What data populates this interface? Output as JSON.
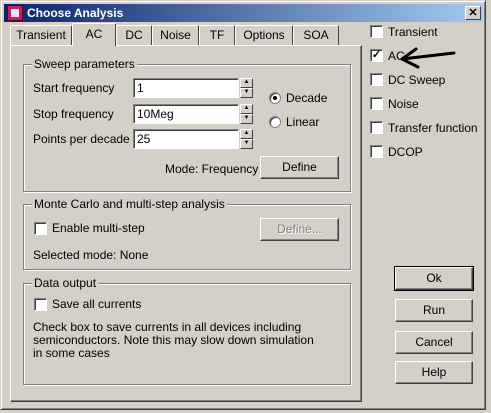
{
  "window": {
    "title": "Choose Analysis",
    "close_glyph": "✕"
  },
  "tabs": [
    "Transient",
    "AC",
    "DC",
    "Noise",
    "TF",
    "Options",
    "SOA"
  ],
  "active_tab": "AC",
  "sweep": {
    "title": "Sweep parameters",
    "start_label": "Start frequency",
    "start_value": "1",
    "stop_label": "Stop frequency",
    "stop_value": "10Meg",
    "points_label": "Points per decade",
    "points_value": "25",
    "decade_label": "Decade",
    "linear_label": "Linear",
    "selected_scale": "Decade",
    "mode_text": "Mode: Frequency",
    "define_label": "Define"
  },
  "montecarlo": {
    "title": "Monte Carlo and multi-step analysis",
    "enable_label": "Enable multi-step",
    "define_label": "Define...",
    "selected_mode": "Selected mode: None"
  },
  "output": {
    "title": "Data output",
    "save_label": "Save all currents",
    "description": [
      "Check box to save currents in all devices including",
      "semiconductors. Note this may slow down simulation",
      "in some cases"
    ]
  },
  "analyses": [
    {
      "label": "Transient",
      "checked": false
    },
    {
      "label": "AC",
      "checked": true
    },
    {
      "label": "DC Sweep",
      "checked": false
    },
    {
      "label": "Noise",
      "checked": false
    },
    {
      "label": "Transfer function",
      "checked": false
    },
    {
      "label": "DCOP",
      "checked": false
    }
  ],
  "buttons": {
    "ok": "Ok",
    "run": "Run",
    "cancel": "Cancel",
    "help": "Help"
  },
  "colors": {
    "title_start": "#0a246a",
    "title_end": "#a6caf0",
    "face": "#d4d0c8"
  }
}
